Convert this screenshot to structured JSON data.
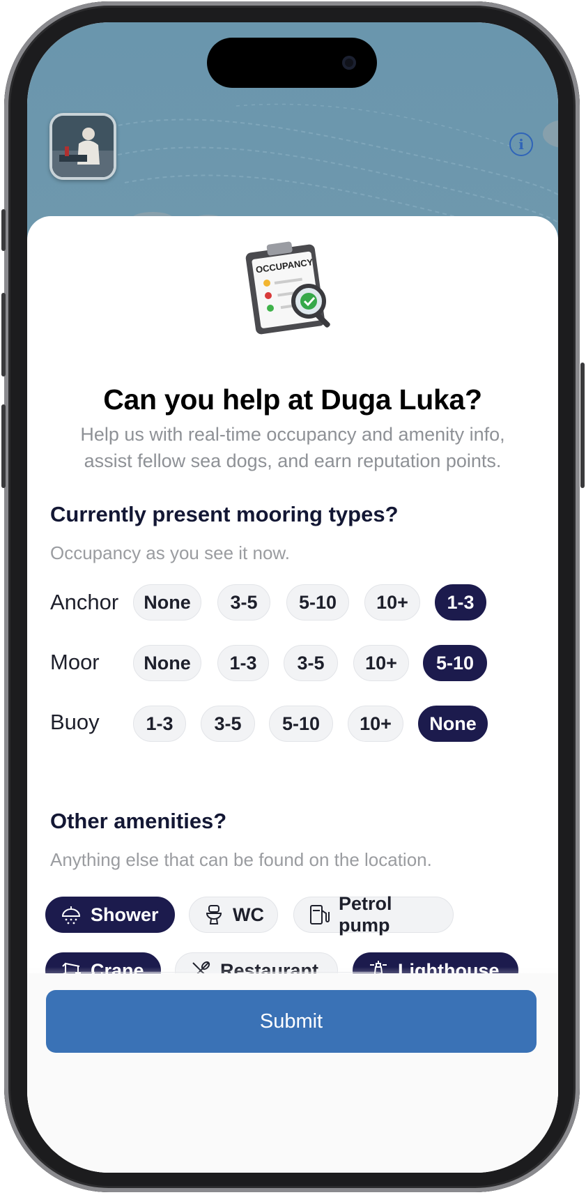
{
  "header": {
    "info_icon": "info-icon",
    "avatar_alt": "profile-avatar"
  },
  "hero": {
    "clipboard_text": "OCCUPANCY",
    "title": "Can you help at Duga Luka?",
    "subtitle": "Help us with real-time occupancy and amenity info, assist fellow sea dogs, and earn reputation points."
  },
  "mooring": {
    "title": "Currently present mooring types?",
    "subtitle": "Occupancy as you see it now.",
    "rows": [
      {
        "label": "Anchor",
        "options": [
          "None",
          "3-5",
          "5-10",
          "10+",
          "1-3"
        ],
        "selected": "1-3"
      },
      {
        "label": "Moor",
        "options": [
          "None",
          "1-3",
          "3-5",
          "10+",
          "5-10"
        ],
        "selected": "5-10"
      },
      {
        "label": "Buoy",
        "options": [
          "1-3",
          "3-5",
          "5-10",
          "10+",
          "None"
        ],
        "selected": "None"
      }
    ]
  },
  "amenities": {
    "title": "Other amenities?",
    "subtitle": "Anything else that can be found on the location.",
    "items": [
      {
        "label": "Shower",
        "icon": "shower-icon",
        "selected": true
      },
      {
        "label": "WC",
        "icon": "toilet-icon",
        "selected": false
      },
      {
        "label": "Petrol pump",
        "icon": "fuel-pump-icon",
        "selected": false
      },
      {
        "label": "Crane",
        "icon": "crane-icon",
        "selected": true
      },
      {
        "label": "Restaurant",
        "icon": "utensils-icon",
        "selected": false
      },
      {
        "label": "Lighthouse",
        "icon": "lighthouse-icon",
        "selected": true
      }
    ]
  },
  "footer": {
    "submit_label": "Submit"
  },
  "colors": {
    "selected_chip": "#1c1b4d",
    "unselected_chip": "#f2f3f5",
    "submit": "#3a72b6",
    "map_water": "#6a96ad",
    "info_accent": "#2f64b8"
  }
}
